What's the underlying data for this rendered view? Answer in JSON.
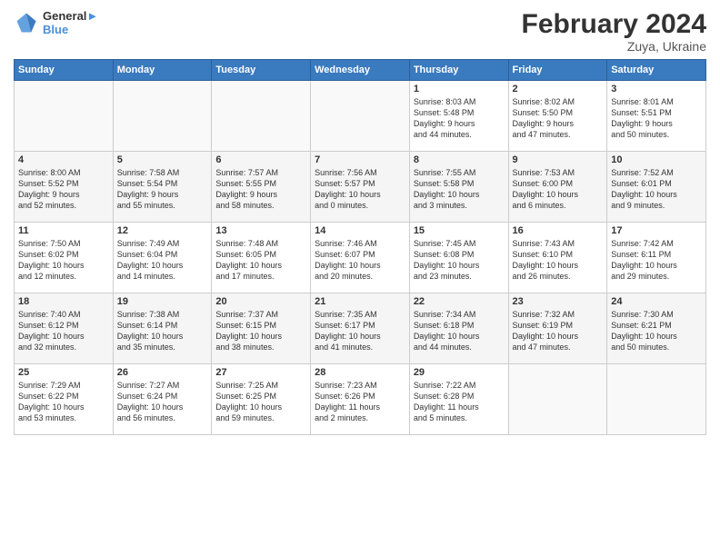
{
  "header": {
    "logo_line1": "General",
    "logo_line2": "Blue",
    "title": "February 2024",
    "subtitle": "Zuya, Ukraine"
  },
  "days_of_week": [
    "Sunday",
    "Monday",
    "Tuesday",
    "Wednesday",
    "Thursday",
    "Friday",
    "Saturday"
  ],
  "weeks": [
    [
      {
        "day": "",
        "info": ""
      },
      {
        "day": "",
        "info": ""
      },
      {
        "day": "",
        "info": ""
      },
      {
        "day": "",
        "info": ""
      },
      {
        "day": "1",
        "info": "Sunrise: 8:03 AM\nSunset: 5:48 PM\nDaylight: 9 hours\nand 44 minutes."
      },
      {
        "day": "2",
        "info": "Sunrise: 8:02 AM\nSunset: 5:50 PM\nDaylight: 9 hours\nand 47 minutes."
      },
      {
        "day": "3",
        "info": "Sunrise: 8:01 AM\nSunset: 5:51 PM\nDaylight: 9 hours\nand 50 minutes."
      }
    ],
    [
      {
        "day": "4",
        "info": "Sunrise: 8:00 AM\nSunset: 5:52 PM\nDaylight: 9 hours\nand 52 minutes."
      },
      {
        "day": "5",
        "info": "Sunrise: 7:58 AM\nSunset: 5:54 PM\nDaylight: 9 hours\nand 55 minutes."
      },
      {
        "day": "6",
        "info": "Sunrise: 7:57 AM\nSunset: 5:55 PM\nDaylight: 9 hours\nand 58 minutes."
      },
      {
        "day": "7",
        "info": "Sunrise: 7:56 AM\nSunset: 5:57 PM\nDaylight: 10 hours\nand 0 minutes."
      },
      {
        "day": "8",
        "info": "Sunrise: 7:55 AM\nSunset: 5:58 PM\nDaylight: 10 hours\nand 3 minutes."
      },
      {
        "day": "9",
        "info": "Sunrise: 7:53 AM\nSunset: 6:00 PM\nDaylight: 10 hours\nand 6 minutes."
      },
      {
        "day": "10",
        "info": "Sunrise: 7:52 AM\nSunset: 6:01 PM\nDaylight: 10 hours\nand 9 minutes."
      }
    ],
    [
      {
        "day": "11",
        "info": "Sunrise: 7:50 AM\nSunset: 6:02 PM\nDaylight: 10 hours\nand 12 minutes."
      },
      {
        "day": "12",
        "info": "Sunrise: 7:49 AM\nSunset: 6:04 PM\nDaylight: 10 hours\nand 14 minutes."
      },
      {
        "day": "13",
        "info": "Sunrise: 7:48 AM\nSunset: 6:05 PM\nDaylight: 10 hours\nand 17 minutes."
      },
      {
        "day": "14",
        "info": "Sunrise: 7:46 AM\nSunset: 6:07 PM\nDaylight: 10 hours\nand 20 minutes."
      },
      {
        "day": "15",
        "info": "Sunrise: 7:45 AM\nSunset: 6:08 PM\nDaylight: 10 hours\nand 23 minutes."
      },
      {
        "day": "16",
        "info": "Sunrise: 7:43 AM\nSunset: 6:10 PM\nDaylight: 10 hours\nand 26 minutes."
      },
      {
        "day": "17",
        "info": "Sunrise: 7:42 AM\nSunset: 6:11 PM\nDaylight: 10 hours\nand 29 minutes."
      }
    ],
    [
      {
        "day": "18",
        "info": "Sunrise: 7:40 AM\nSunset: 6:12 PM\nDaylight: 10 hours\nand 32 minutes."
      },
      {
        "day": "19",
        "info": "Sunrise: 7:38 AM\nSunset: 6:14 PM\nDaylight: 10 hours\nand 35 minutes."
      },
      {
        "day": "20",
        "info": "Sunrise: 7:37 AM\nSunset: 6:15 PM\nDaylight: 10 hours\nand 38 minutes."
      },
      {
        "day": "21",
        "info": "Sunrise: 7:35 AM\nSunset: 6:17 PM\nDaylight: 10 hours\nand 41 minutes."
      },
      {
        "day": "22",
        "info": "Sunrise: 7:34 AM\nSunset: 6:18 PM\nDaylight: 10 hours\nand 44 minutes."
      },
      {
        "day": "23",
        "info": "Sunrise: 7:32 AM\nSunset: 6:19 PM\nDaylight: 10 hours\nand 47 minutes."
      },
      {
        "day": "24",
        "info": "Sunrise: 7:30 AM\nSunset: 6:21 PM\nDaylight: 10 hours\nand 50 minutes."
      }
    ],
    [
      {
        "day": "25",
        "info": "Sunrise: 7:29 AM\nSunset: 6:22 PM\nDaylight: 10 hours\nand 53 minutes."
      },
      {
        "day": "26",
        "info": "Sunrise: 7:27 AM\nSunset: 6:24 PM\nDaylight: 10 hours\nand 56 minutes."
      },
      {
        "day": "27",
        "info": "Sunrise: 7:25 AM\nSunset: 6:25 PM\nDaylight: 10 hours\nand 59 minutes."
      },
      {
        "day": "28",
        "info": "Sunrise: 7:23 AM\nSunset: 6:26 PM\nDaylight: 11 hours\nand 2 minutes."
      },
      {
        "day": "29",
        "info": "Sunrise: 7:22 AM\nSunset: 6:28 PM\nDaylight: 11 hours\nand 5 minutes."
      },
      {
        "day": "",
        "info": ""
      },
      {
        "day": "",
        "info": ""
      }
    ]
  ]
}
